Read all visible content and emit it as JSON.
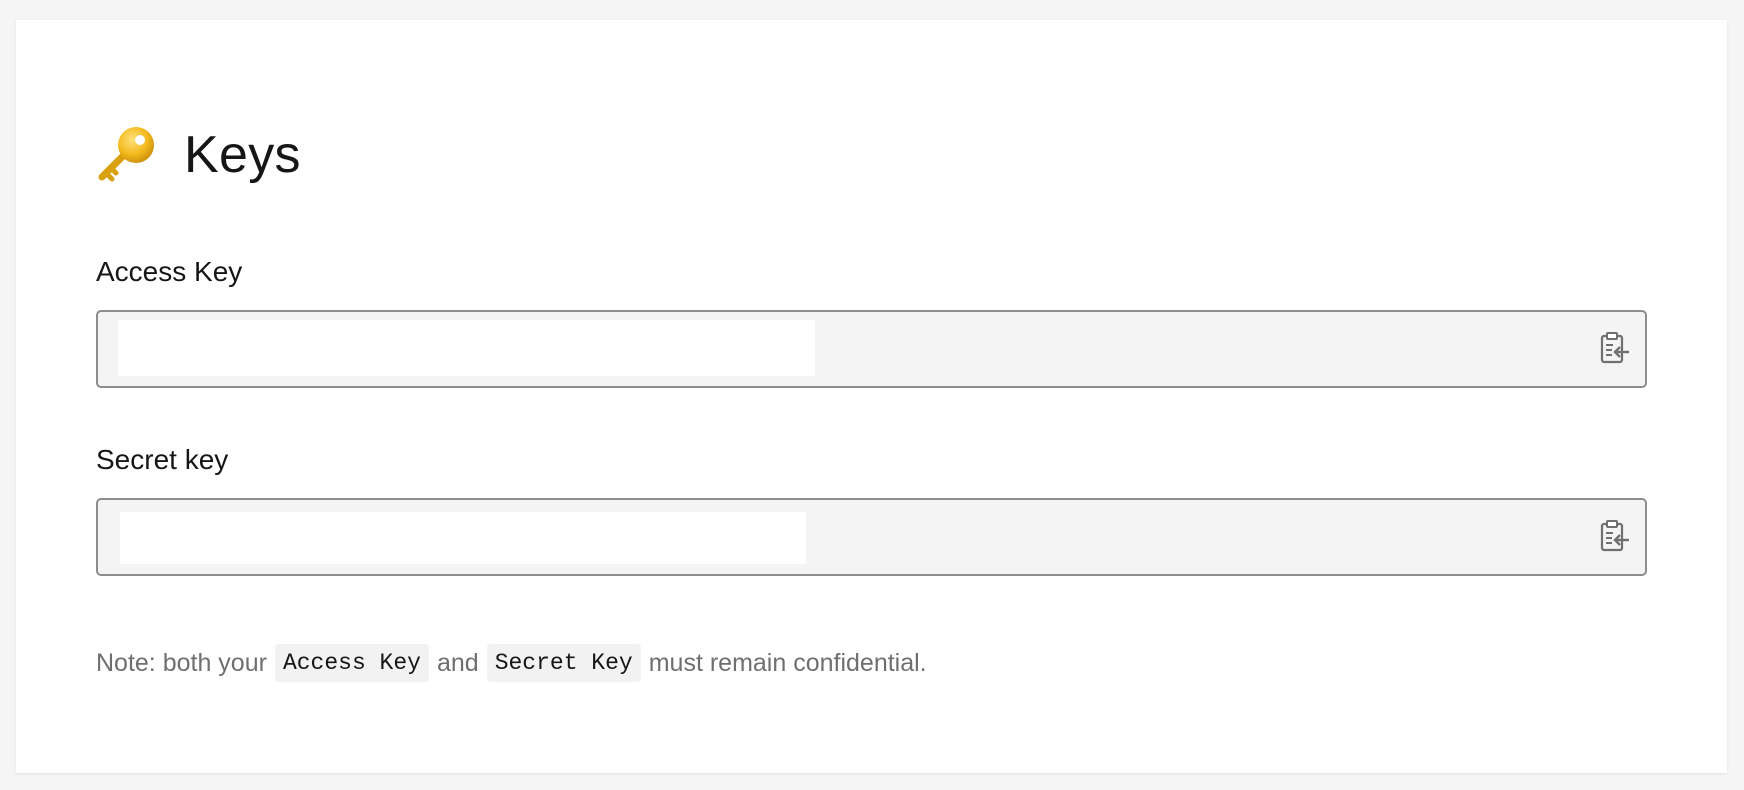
{
  "page": {
    "title": "Keys",
    "title_icon": "key-icon"
  },
  "fields": {
    "access": {
      "label": "Access Key",
      "value": "",
      "action_icon": "paste-icon"
    },
    "secret": {
      "label": "Secret key",
      "value": "",
      "action_icon": "paste-icon"
    }
  },
  "note": {
    "prefix": "Note: both your",
    "code1": "Access Key",
    "middle": "and",
    "code2": "Secret Key",
    "suffix": "must remain confidential."
  },
  "colors": {
    "field_background": "#f4f4f4",
    "field_border": "#8d8d8d",
    "note_text": "#6f6f6f",
    "key_gold": "#e8b21c"
  }
}
